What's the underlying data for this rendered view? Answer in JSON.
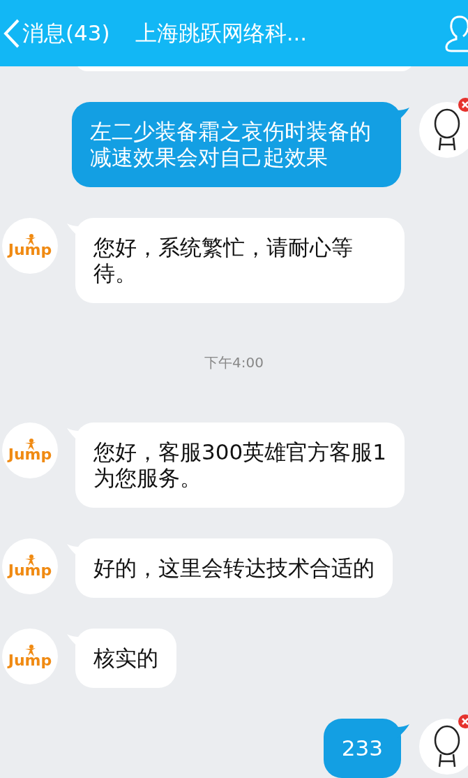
{
  "header": {
    "back_label": "消息(43)",
    "title": "上海跳跃网络科..."
  },
  "messages": [
    {
      "kind": "cut"
    },
    {
      "kind": "outgoing",
      "text": "左二少装备霜之哀伤时装备的减速效果会对自己起效果",
      "failed": true
    },
    {
      "kind": "incoming",
      "text": "您好，系统繁忙，请耐心等待。",
      "avatar_text": "Jump"
    },
    {
      "kind": "time",
      "text": "下午4:00"
    },
    {
      "kind": "incoming",
      "text": "您好，客服300英雄官方客服1为您服务。",
      "avatar_text": "Jump"
    },
    {
      "kind": "incoming",
      "text": "好的，这里会转达技术合适的",
      "avatar_text": "Jump"
    },
    {
      "kind": "incoming",
      "text": "核实的",
      "avatar_text": "Jump"
    },
    {
      "kind": "outgoing",
      "text": "233",
      "failed": true
    }
  ]
}
